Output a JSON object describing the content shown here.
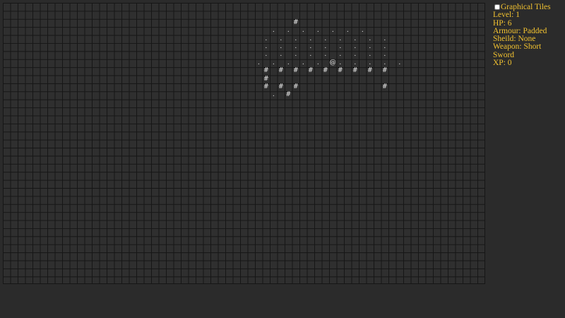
{
  "sidebar": {
    "graphical_tiles": {
      "label": "Graphical Tiles",
      "checked": false
    },
    "level": "Level: 1",
    "hp": "HP: 6",
    "armour": "Armour: Padded",
    "sheild": "Sheild: None",
    "weapon": "Weapon: Short Sword",
    "xp": "XP: 0"
  },
  "map": {
    "rows": [
      {
        "row": 2,
        "text": "                                       #"
      },
      {
        "row": 3,
        "text": "                                    . . . . . . ."
      },
      {
        "row": 4,
        "text": "                                   . . . . . . . . ."
      },
      {
        "row": 5,
        "text": "                                   . . . . . . . . ."
      },
      {
        "row": 6,
        "text": "                                   . . . . . . . . ."
      },
      {
        "row": 7,
        "text": "                                  . . . . . @. . . . ."
      },
      {
        "row": 8,
        "text": "                                   # # # # # # # # #"
      },
      {
        "row": 9,
        "text": "                                   #"
      },
      {
        "row": 10,
        "text": "                                   # # #           #"
      },
      {
        "row": 11,
        "text": "                                    . #"
      }
    ]
  },
  "colors": {
    "panel_text": "#f2c230",
    "glyph": "#e8e8e8",
    "grid_line": "#161616",
    "cell_bg": "#2f2f2f",
    "page_bg": "#2b2b2b"
  }
}
